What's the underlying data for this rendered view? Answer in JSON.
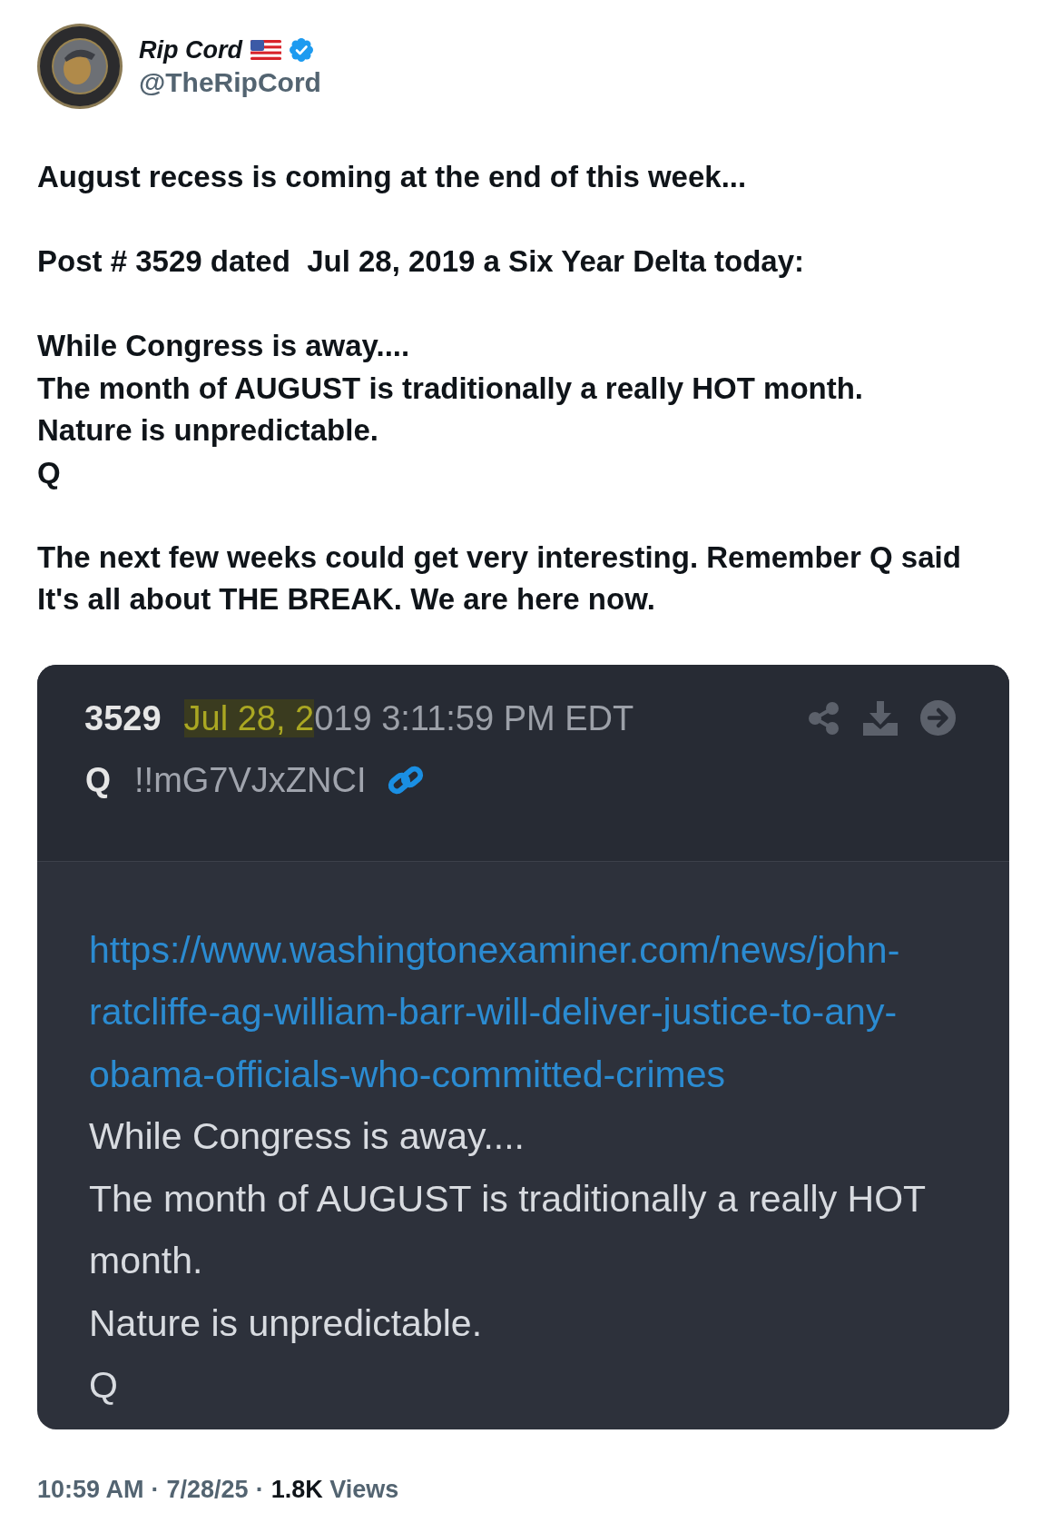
{
  "author": {
    "name": "Rip Cord",
    "handle": "@TheRipCord",
    "verified": true
  },
  "tweet": {
    "paragraphs": [
      {
        "lines": [
          "August recess is coming at the end of this week..."
        ]
      },
      {
        "lines": [
          "Post # 3529 dated  Jul 28, 2019 a Six Year Delta today:"
        ]
      },
      {
        "lines": [
          "While Congress is away....",
          "The month of AUGUST is traditionally a really HOT month.",
          "Nature is unpredictable.",
          "Q"
        ]
      },
      {
        "lines": [
          "The next few weeks could get very interesting. Remember Q said It's all about THE BREAK. We are here now."
        ]
      }
    ]
  },
  "quoted_post": {
    "number": "3529",
    "date": {
      "highlight": "Jul 28, 2",
      "rest": "019 3:11:59 PM EDT"
    },
    "author": "Q",
    "tripcode": "!!mG7VJxZNCI",
    "link": "https://www.washingtonexaminer.com/news/john-ratcliffe-ag-william-barr-will-deliver-justice-to-any-obama-officials-who-committed-crimes",
    "lines": [
      "While Congress is away....",
      "The month of AUGUST is traditionally a really HOT month.",
      "Nature is unpredictable.",
      "Q"
    ]
  },
  "footer": {
    "time": "10:59 AM",
    "separators": [
      "·",
      "·"
    ],
    "date": "7/28/25",
    "views_count": "1.8K",
    "views_label": "Views"
  }
}
